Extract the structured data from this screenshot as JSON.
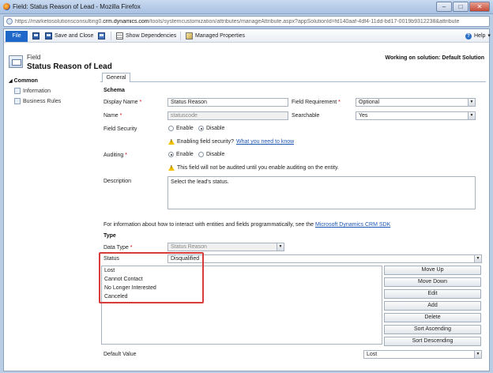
{
  "window": {
    "title": "Field: Status Reason of Lead - Mozilla Firefox",
    "minimize": "–",
    "maximize": "□",
    "close": "✕"
  },
  "address_bar": {
    "prefix": "https://marketosolutionsconsulting0.",
    "domain": "crm.dynamics.com",
    "suffix": "/tools/systemcustomization/attributes/manageAttribute.aspx?appSolutionId=fd140aaf-4df4-11dd-bd17-0019b9312238&attribute"
  },
  "ribbon": {
    "file": "File",
    "save_close": "Save and Close",
    "show_dependencies": "Show Dependencies",
    "managed_properties": "Managed Properties",
    "help": "Help",
    "help_caret": "▾"
  },
  "header": {
    "type_label": "Field",
    "title": "Status Reason of Lead",
    "solution": "Working on solution: Default Solution"
  },
  "nav": {
    "section": "Common",
    "items": [
      "Information",
      "Business Rules"
    ]
  },
  "tab": "General",
  "schema": {
    "title": "Schema",
    "display_name_label": "Display Name",
    "display_name_value": "Status Reason",
    "field_requirement_label": "Field Requirement",
    "field_requirement_value": "Optional",
    "name_label": "Name",
    "name_value": "statuscode",
    "searchable_label": "Searchable",
    "searchable_value": "Yes",
    "field_security_label": "Field Security",
    "enable": "Enable",
    "disable": "Disable",
    "security_warning": "Enabling field security?",
    "security_link": "What you need to know",
    "auditing_label": "Auditing",
    "auditing_warning": "This field will not be audited until you enable auditing on the entity.",
    "description_label": "Description",
    "description_value": "Select the lead's status.",
    "required_mark": "*",
    "info_text": "For information about how to interact with entities and fields programmatically, see the",
    "sdk_link": "Microsoft Dynamics CRM SDK"
  },
  "type_section": {
    "title": "Type",
    "data_type_label": "Data Type",
    "data_type_value": "Status Reason",
    "status_label": "Status",
    "status_value": "Disqualified",
    "options": [
      "Lost",
      "Cannot Contact",
      "No Longer Interested",
      "Canceled"
    ],
    "buttons": [
      "Move Up",
      "Move Down",
      "Edit",
      "Add",
      "Delete",
      "Sort Ascending",
      "Sort Descending"
    ],
    "default_value_label": "Default Value",
    "default_value": "Lost"
  },
  "colors": {
    "highlight": "#d93a3a",
    "file_button": "#1e68c9",
    "link": "#1a55b5"
  }
}
